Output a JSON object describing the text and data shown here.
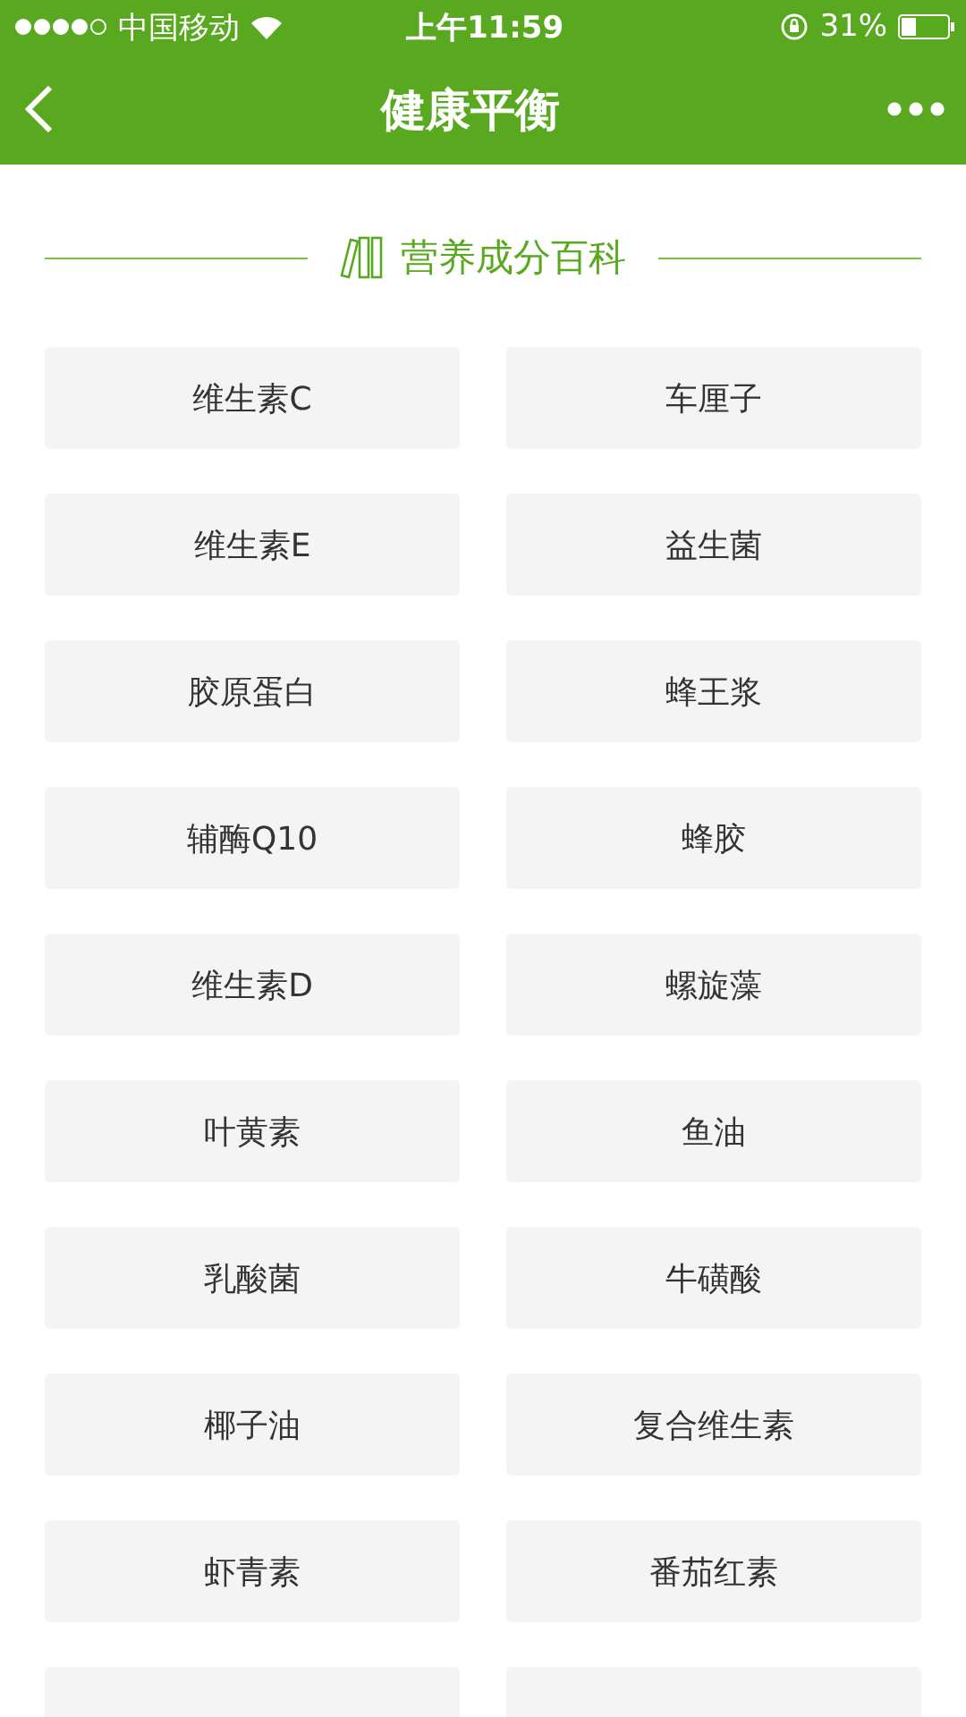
{
  "status_bar": {
    "carrier": "中国移动",
    "time": "上午11:59",
    "battery": "31%"
  },
  "nav": {
    "title": "健康平衡"
  },
  "section": {
    "title": "营养成分百科"
  },
  "items": [
    {
      "label": "维生素C"
    },
    {
      "label": "车厘子"
    },
    {
      "label": "维生素E"
    },
    {
      "label": "益生菌"
    },
    {
      "label": "胶原蛋白"
    },
    {
      "label": "蜂王浆"
    },
    {
      "label": "辅酶Q10"
    },
    {
      "label": "蜂胶"
    },
    {
      "label": "维生素D"
    },
    {
      "label": "螺旋藻"
    },
    {
      "label": "叶黄素"
    },
    {
      "label": "鱼油"
    },
    {
      "label": "乳酸菌"
    },
    {
      "label": "牛磺酸"
    },
    {
      "label": "椰子油"
    },
    {
      "label": "复合维生素"
    },
    {
      "label": "虾青素"
    },
    {
      "label": "番茄红素"
    }
  ]
}
